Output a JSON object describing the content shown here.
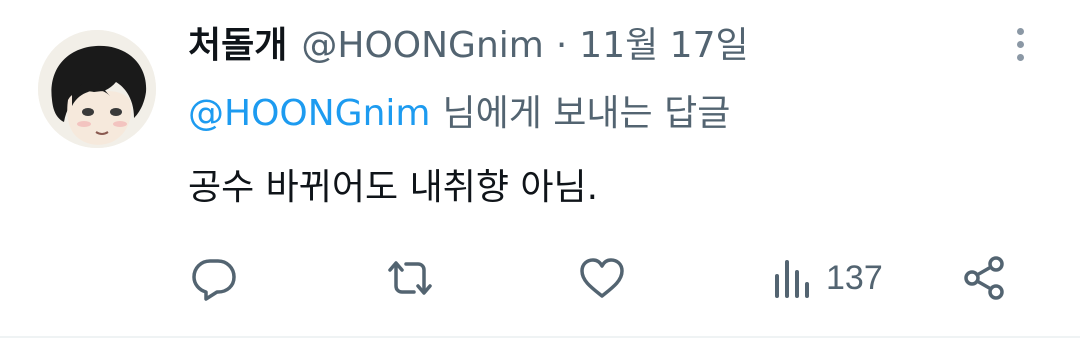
{
  "tweet": {
    "display_name": "처돌개",
    "handle": "@HOONGnim",
    "separator": "·",
    "date": "11월 17일",
    "reply_to_handle": "@HOONGnim",
    "reply_to_suffix": "님에게 보내는 답글",
    "text": "공수 바뀌어도 내취향 아님."
  },
  "actions": {
    "reply_icon": "speech-bubble-icon",
    "retweet_icon": "retweet-arrows-icon",
    "like_icon": "heart-icon",
    "views_icon": "bar-chart-icon",
    "views_count": "137",
    "share_icon": "share-icon"
  },
  "colors": {
    "link": "#1d9bf0",
    "secondary_text": "#536471",
    "primary_text": "#0f1419"
  }
}
